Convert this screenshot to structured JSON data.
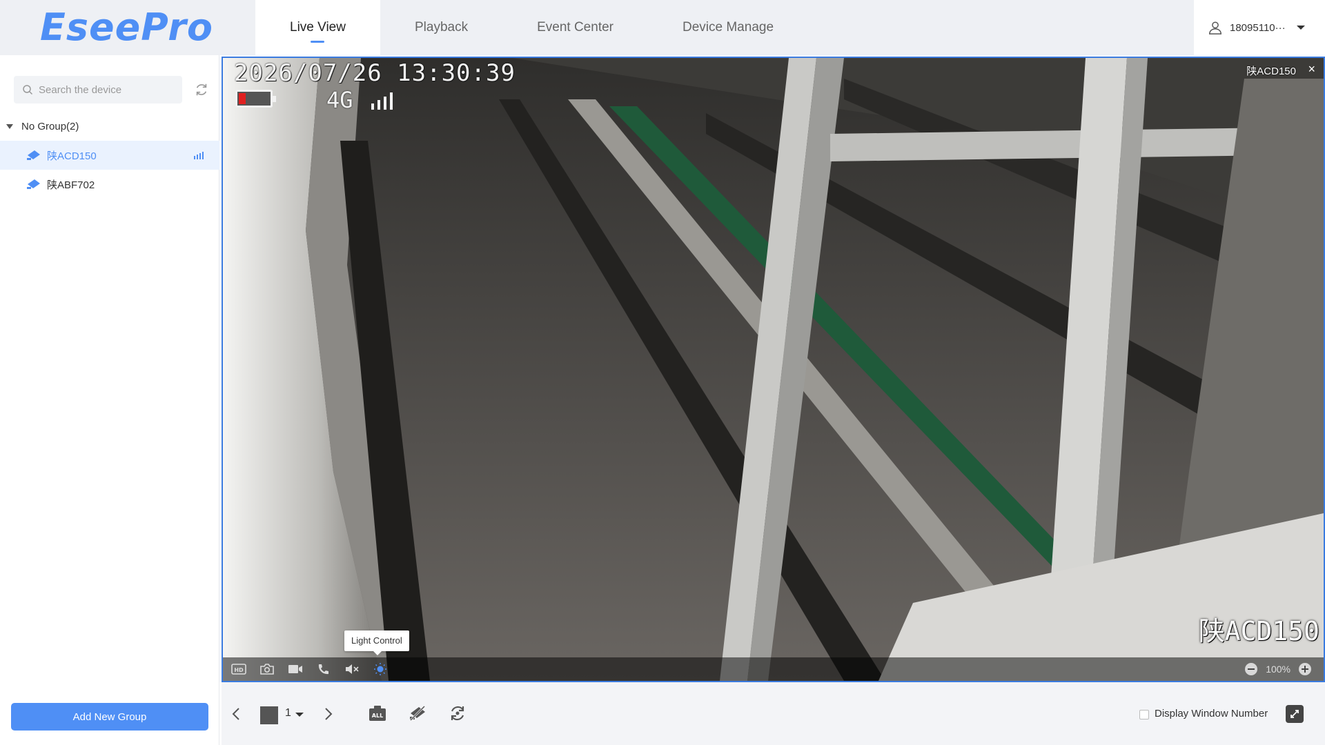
{
  "app": {
    "logo": "EseePro"
  },
  "nav": {
    "tabs": [
      {
        "label": "Live View",
        "active": true
      },
      {
        "label": "Playback",
        "active": false
      },
      {
        "label": "Event Center",
        "active": false
      },
      {
        "label": "Device Manage",
        "active": false
      }
    ]
  },
  "user": {
    "name": "18095110···"
  },
  "sidebar": {
    "search_placeholder": "Search the device",
    "group": {
      "label": "No Group(2)"
    },
    "devices": [
      {
        "name": "陕ACD150",
        "selected": true
      },
      {
        "name": "陕ABF702",
        "selected": false
      }
    ],
    "add_group_label": "Add New Group"
  },
  "video": {
    "osd_datetime": "2026/07/26 13:30:39",
    "osd_network": "4G",
    "window_label": "陕ACD150",
    "close_glyph": "×",
    "osd_plate": "陕ACD150",
    "tooltip": "Light Control",
    "controls": [
      "hd-icon",
      "snapshot-icon",
      "record-icon",
      "talk-icon",
      "mute-icon",
      "light-icon"
    ],
    "zoom": "100%"
  },
  "bottom": {
    "page_number": "1",
    "display_window_number_label": "Display Window Number"
  },
  "colors": {
    "accent": "#4f8ff5",
    "header_bg": "#eef0f4",
    "selected_bg": "#eaf2fe"
  }
}
